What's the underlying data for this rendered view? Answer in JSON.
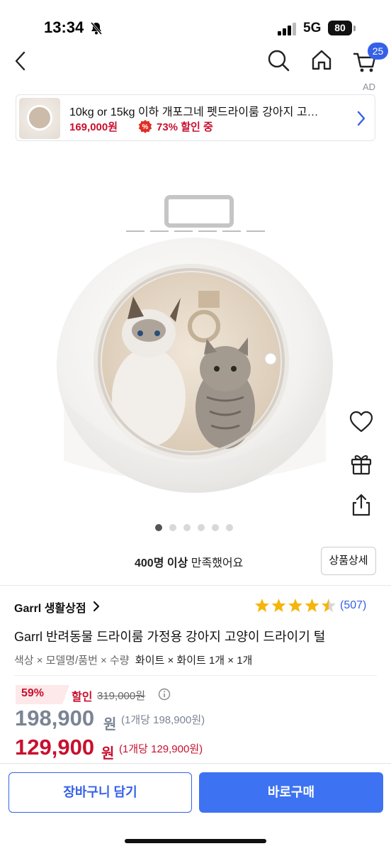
{
  "status_bar": {
    "time": "13:34",
    "network": "5G",
    "battery": "80"
  },
  "nav": {
    "cart_count": "25",
    "icons": [
      "back-icon",
      "search-icon",
      "home-icon",
      "cart-icon"
    ]
  },
  "ad": {
    "label": "AD",
    "title": "10kg or 15kg 이하 개포그네 펫드라이룸 강아지 고…",
    "price": "169,000원",
    "discount": "73% 할인 중"
  },
  "gallery": {
    "dot_count": 6,
    "active_index": 0
  },
  "satisfaction": {
    "strong": "400명 이상",
    "rest": " 만족했어요"
  },
  "detail_button": "상품상세",
  "store": {
    "name": "Garrl 생활상점"
  },
  "rating": {
    "stars": 4.5,
    "count": "(507)"
  },
  "product": {
    "title": "Garrl 반려동물 드라이룸 가정용 강아지 고양이 드라이기 털",
    "option_label": "색상 × 모델명/품번 × 수량",
    "option_value": "화이트 × 화이트 1개 × 1개"
  },
  "pricing": {
    "discount_rate": "59%",
    "sale_label": "할인",
    "original_price": "319,000원",
    "price_before": "198,900",
    "price_before_won": "원",
    "price_before_unit": "(1개당 198,900원)",
    "final_price": "129,900",
    "final_price_won": "원",
    "final_price_unit": "(1개당 129,900원)"
  },
  "actions": {
    "cart": "장바구니 담기",
    "buy": "바로구매"
  },
  "colors": {
    "accent_blue": "#3461e8",
    "sale_red": "#c8102e",
    "star_yellow": "#f5b50a"
  }
}
